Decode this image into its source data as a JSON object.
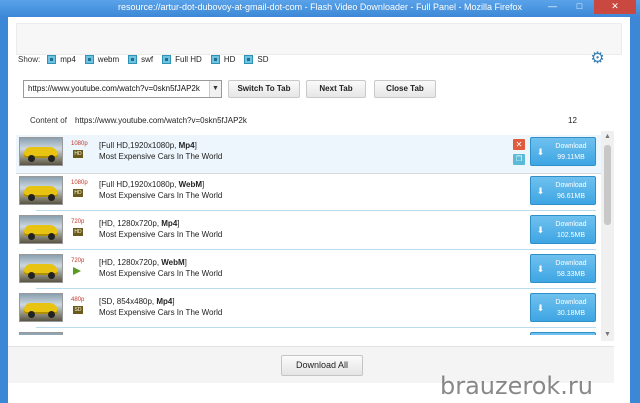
{
  "window": {
    "title": "resource://artur-dot-dubovoy-at-gmail-dot-com - Flash Video Downloader - Full Panel - Mozilla Firefox",
    "minimize": "—",
    "maximize": "□",
    "close": "✕"
  },
  "filters": {
    "label": "Show:",
    "options": [
      "mp4",
      "webm",
      "swf",
      "Full HD",
      "HD",
      "SD"
    ]
  },
  "toolbar": {
    "url_value": "https://www.youtube.com/watch?v=0skn5fJAP2k",
    "switch_tab": "Switch To Tab",
    "next_tab": "Next Tab",
    "close_tab": "Close Tab"
  },
  "content": {
    "label": "Content of",
    "url": "https://www.youtube.com/watch?v=0skn5fJAP2k",
    "count": "12"
  },
  "items": [
    {
      "res": "1080p",
      "quality": "[Full HD,1920x1080p, ",
      "format": "Mp4",
      "suffix": "]",
      "title": "Most Expensive Cars In The World",
      "dl_label": "Download",
      "size": "99.11MB"
    },
    {
      "res": "1080p",
      "quality": "[Full HD,1920x1080p, ",
      "format": "WebM",
      "suffix": "]",
      "title": "Most Expensive Cars In The World",
      "dl_label": "Download",
      "size": "96.61MB"
    },
    {
      "res": "720p",
      "quality": "[HD, 1280x720p, ",
      "format": "Mp4",
      "suffix": "]",
      "title": "Most Expensive Cars In The World",
      "dl_label": "Download",
      "size": "102.5MB"
    },
    {
      "res": "720p",
      "quality": "[HD, 1280x720p, ",
      "format": "WebM",
      "suffix": "]",
      "title": "Most Expensive Cars In The World",
      "dl_label": "Download",
      "size": "58.33MB"
    },
    {
      "res": "480p",
      "quality": "[SD, 854x480p, ",
      "format": "Mp4",
      "suffix": "]",
      "title": "Most Expensive Cars In The World",
      "dl_label": "Download",
      "size": "30.18MB"
    }
  ],
  "actions": {
    "remove": "✕",
    "copy": "❐"
  },
  "footer": {
    "download_all": "Download All"
  },
  "watermark": "brauzerok.ru",
  "colors": {
    "accent": "#3ea5e3",
    "frame": "#3c88d6",
    "remove": "#e05c3c"
  }
}
